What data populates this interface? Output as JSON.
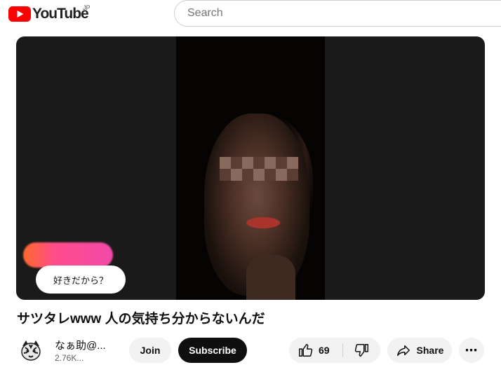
{
  "header": {
    "logo_text": "YouTube",
    "region": "JP",
    "search_placeholder": "Search",
    "brand_color": "#ff0000"
  },
  "video": {
    "overlay_caption": "好きだから？",
    "title": "サツタレwww 人の気持ち分からないんだ"
  },
  "channel": {
    "name": "なぁ助@...",
    "subscribers": "2.76K..."
  },
  "actions": {
    "join_label": "Join",
    "subscribe_label": "Subscribe",
    "like_count": "69",
    "share_label": "Share",
    "more_label": "⋯"
  }
}
